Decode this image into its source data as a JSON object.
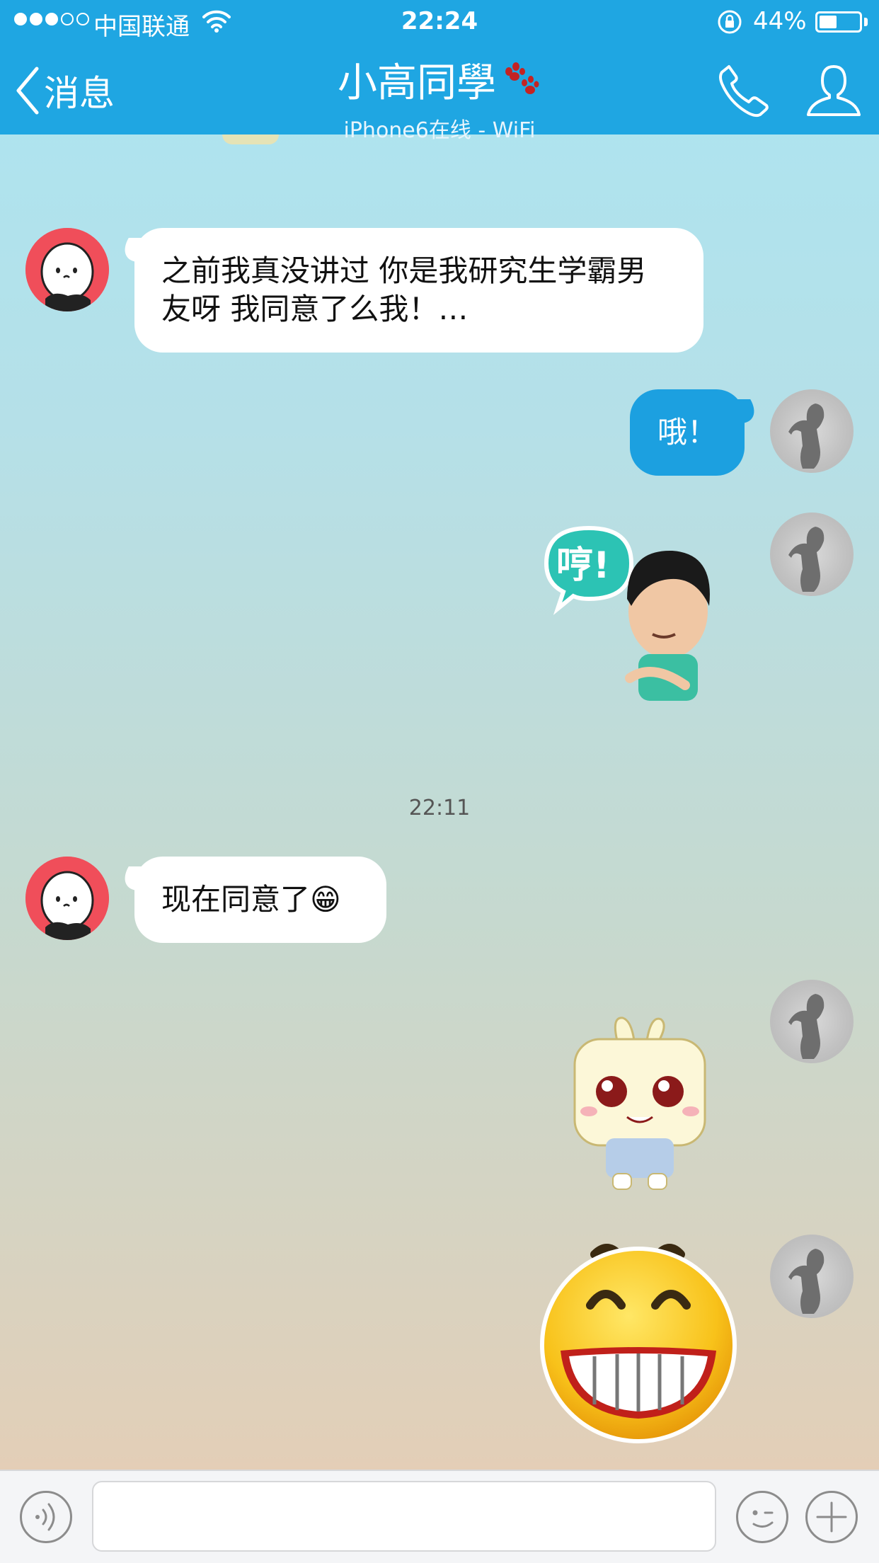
{
  "status_bar": {
    "signal_bars_filled": 3,
    "signal_bars_total": 5,
    "carrier": "中国联通",
    "time": "22:24",
    "battery_percent": "44%",
    "battery_level": 0.44
  },
  "nav": {
    "back_label": "消息",
    "title": "小高同學",
    "subtitle": "iPhone6在线 - WiFi"
  },
  "messages": [
    {
      "sender": "friend",
      "type": "text",
      "text_line1": "之前我真没讲过 你是我研究生学霸男",
      "text_line2": "友呀 我同意了么我！…"
    },
    {
      "sender": "me",
      "type": "text",
      "text": "哦！"
    },
    {
      "sender": "me",
      "type": "sticker",
      "sticker_text": "哼!",
      "sticker_name": "humph-guy-sticker"
    },
    {
      "type": "timestamp",
      "text": "22:11"
    },
    {
      "sender": "friend",
      "type": "text",
      "text": "现在同意了😁"
    },
    {
      "sender": "me",
      "type": "sticker",
      "sticker_name": "tofu-bunny-sticker"
    },
    {
      "sender": "me",
      "type": "sticker",
      "sticker_name": "big-grin-emoji-sticker"
    }
  ],
  "input_bar": {
    "text_value": "",
    "icons": [
      "voice-icon",
      "emoji-icon",
      "plus-icon"
    ]
  },
  "colors": {
    "nav_bar": "#1fa6e2",
    "my_bubble": "#1ca0e0",
    "friend_bubble": "#ffffff",
    "friend_avatar": "#f04e5a"
  }
}
